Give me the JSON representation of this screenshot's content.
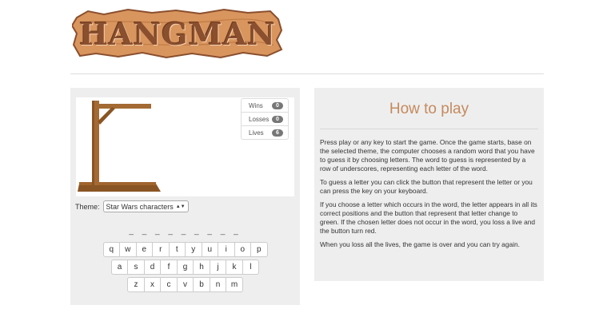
{
  "logo": {
    "text": "HANGMAN"
  },
  "stats": [
    {
      "label": "Wins",
      "value": "0"
    },
    {
      "label": "Losses",
      "value": "0"
    },
    {
      "label": "Lives",
      "value": "6"
    }
  ],
  "theme": {
    "label": "Theme:",
    "selected": "Star Wars characters"
  },
  "word": {
    "display": "_ _ _ _ _ _ _ _ _"
  },
  "keyboard": {
    "row1": [
      "q",
      "w",
      "e",
      "r",
      "t",
      "y",
      "u",
      "i",
      "o",
      "p"
    ],
    "row2": [
      "a",
      "s",
      "d",
      "f",
      "g",
      "h",
      "j",
      "k",
      "l"
    ],
    "row3": [
      "z",
      "x",
      "c",
      "v",
      "b",
      "n",
      "m"
    ]
  },
  "help": {
    "title": "How to play",
    "paragraphs": [
      "Press play or any key to start the game. Once the game starts, base on the selected theme, the computer chooses a random word that you have to guess it by choosing letters. The word to guess is represented by a row of underscores, representing each letter of the word.",
      "To guess a letter you can click the button that represent the letter or you can press the key on your keyboard.",
      "If you choose a letter which occurs in the word, the letter appears in all its correct positions and the button that represent that letter change to green. If the chosen letter does not occur in the word, you loss a live and the button turn red.",
      "When you loss all the lives, the game is over and you can try again."
    ]
  },
  "colors": {
    "wood": "#a0642d",
    "title_accent": "#c58a5e",
    "panel_bg": "#eeeeee"
  }
}
